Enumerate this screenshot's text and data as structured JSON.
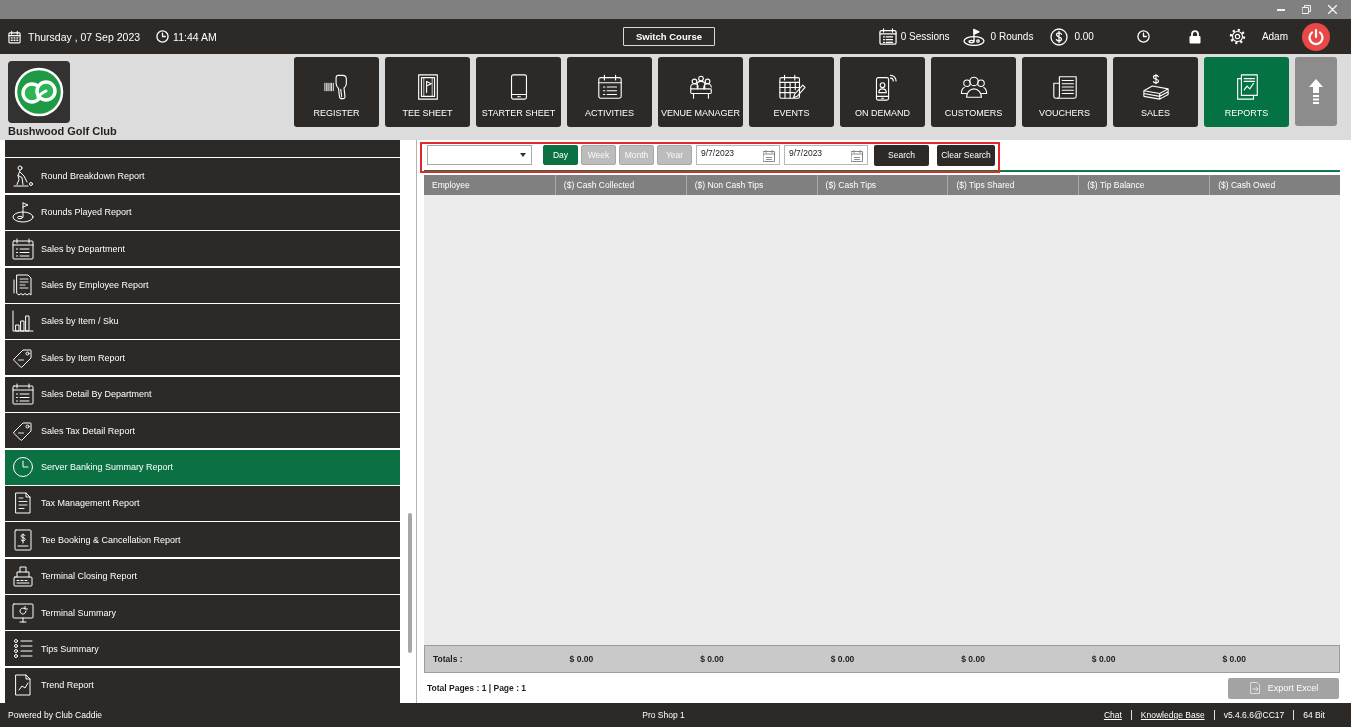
{
  "header": {
    "date": "Thursday , 07 Sep 2023",
    "time": "11:44 AM",
    "switch_course": "Switch Course",
    "sessions": "0 Sessions",
    "rounds": "0 Rounds",
    "balance": "0.00",
    "user": "Adam"
  },
  "club": {
    "name": "Bushwood Golf Club"
  },
  "nav": [
    {
      "label": "REGISTER",
      "selected": false
    },
    {
      "label": "TEE SHEET",
      "selected": false
    },
    {
      "label": "STARTER SHEET",
      "selected": false
    },
    {
      "label": "ACTIVITIES",
      "selected": false
    },
    {
      "label": "VENUE MANAGER",
      "selected": false
    },
    {
      "label": "EVENTS",
      "selected": false
    },
    {
      "label": "ON DEMAND",
      "selected": false
    },
    {
      "label": "CUSTOMERS",
      "selected": false
    },
    {
      "label": "VOUCHERS",
      "selected": false
    },
    {
      "label": "SALES",
      "selected": false
    },
    {
      "label": "REPORTS",
      "selected": true
    }
  ],
  "sidebar": {
    "items": [
      {
        "selected": false
      },
      {
        "label": "Round Breakdown Report",
        "selected": false
      },
      {
        "label": "Rounds Played Report",
        "selected": false
      },
      {
        "label": "Sales by Department",
        "selected": false
      },
      {
        "label": "Sales By Employee Report",
        "selected": false
      },
      {
        "label": "Sales by Item / Sku",
        "selected": false
      },
      {
        "label": "Sales by Item Report",
        "selected": false
      },
      {
        "label": "Sales Detail By Department",
        "selected": false
      },
      {
        "label": "Sales Tax Detail Report",
        "selected": false
      },
      {
        "label": "Server Banking Summary Report",
        "selected": true
      },
      {
        "label": "Tax Management Report",
        "selected": false
      },
      {
        "label": "Tee Booking & Cancellation Report",
        "selected": false
      },
      {
        "label": "Terminal Closing Report",
        "selected": false
      },
      {
        "label": "Terminal Summary",
        "selected": false
      },
      {
        "label": "Tips Summary",
        "selected": false
      },
      {
        "label": "Trend Report",
        "selected": false
      }
    ]
  },
  "filters": {
    "periods": [
      {
        "label": "Day",
        "selected": true
      },
      {
        "label": "Week",
        "selected": false
      },
      {
        "label": "Month",
        "selected": false
      },
      {
        "label": "Year",
        "selected": false
      }
    ],
    "date_from": "9/7/2023",
    "date_to": "9/7/2023",
    "buttons": [
      "Search",
      "Clear Search"
    ]
  },
  "table": {
    "columns": [
      "Employee",
      "($) Cash Collected",
      "($) Non Cash Tips",
      "($) Cash Tips",
      "($) Tips Shared",
      "($) Tip Balance",
      "($) Cash Owed"
    ],
    "totals": {
      "label": "Totals :",
      "values": [
        "$ 0.00",
        "$ 0.00",
        "$ 0.00",
        "$ 0.00",
        "$ 0.00",
        "$ 0.00"
      ]
    }
  },
  "pagination": "Total Pages : 1 | Page : 1",
  "export_button": "Export Excel",
  "footer": {
    "powered_by": "Powered by Club Caddie",
    "location": "Pro Shop 1",
    "links": [
      "Chat",
      "Knowledge Base"
    ],
    "version": "v5.4.6.6@CC17",
    "arch": "64 Bit"
  }
}
